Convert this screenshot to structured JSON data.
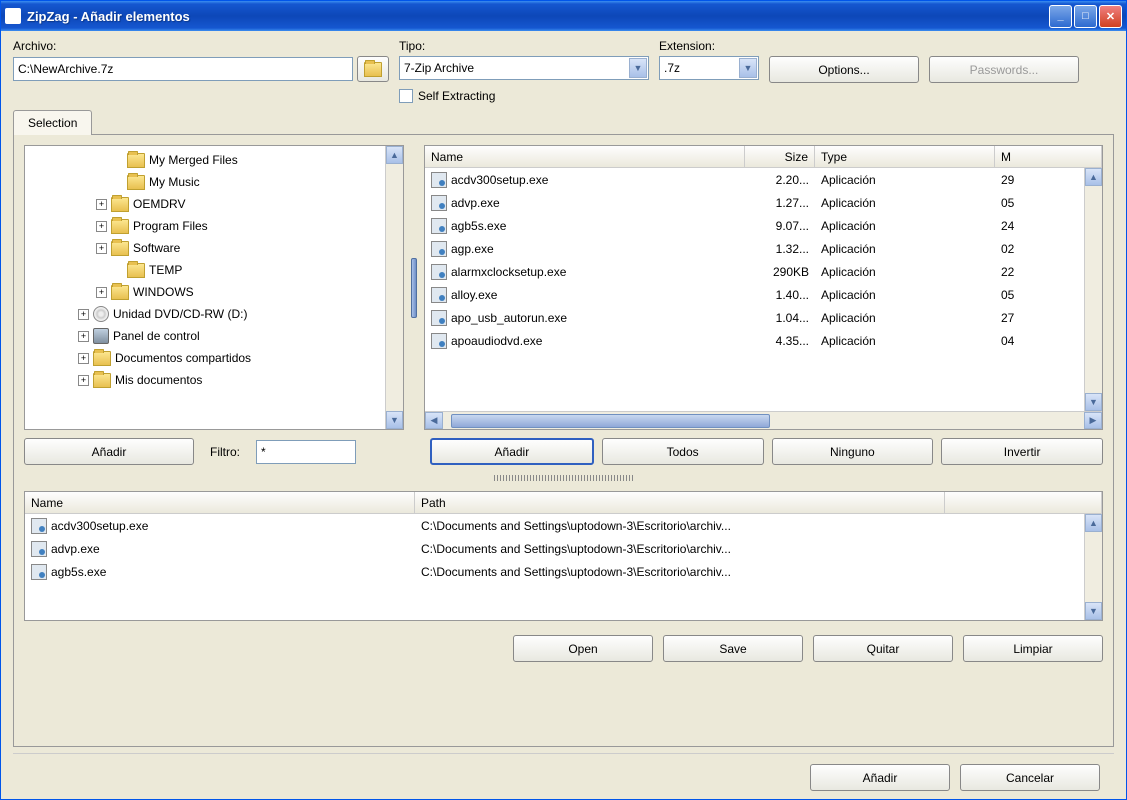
{
  "window": {
    "title": "ZipZag - Añadir elementos"
  },
  "fields": {
    "archivo_label": "Archivo:",
    "archivo_value": "C:\\NewArchive.7z",
    "tipo_label": "Tipo:",
    "tipo_value": "7-Zip Archive",
    "extension_label": "Extension:",
    "extension_value": ".7z",
    "options_btn": "Options...",
    "passwords_btn": "Passwords...",
    "self_extracting": "Self Extracting"
  },
  "tab": {
    "selection": "Selection"
  },
  "tree": {
    "items": [
      {
        "indent": 80,
        "expand": "",
        "icon": "folder",
        "label": "My Merged Files"
      },
      {
        "indent": 80,
        "expand": "",
        "icon": "folder",
        "label": "My Music"
      },
      {
        "indent": 64,
        "expand": "+",
        "icon": "folder",
        "label": "OEMDRV"
      },
      {
        "indent": 64,
        "expand": "+",
        "icon": "folder",
        "label": "Program Files"
      },
      {
        "indent": 64,
        "expand": "+",
        "icon": "folder",
        "label": "Software"
      },
      {
        "indent": 80,
        "expand": "",
        "icon": "folder",
        "label": "TEMP"
      },
      {
        "indent": 64,
        "expand": "+",
        "icon": "folder",
        "label": "WINDOWS"
      },
      {
        "indent": 46,
        "expand": "+",
        "icon": "cd",
        "label": "Unidad DVD/CD-RW (D:)"
      },
      {
        "indent": 46,
        "expand": "+",
        "icon": "panel",
        "label": "Panel de control"
      },
      {
        "indent": 46,
        "expand": "+",
        "icon": "folder",
        "label": "Documentos compartidos"
      },
      {
        "indent": 46,
        "expand": "+",
        "icon": "folder",
        "label": "Mis documentos"
      }
    ]
  },
  "filelist": {
    "cols": {
      "name": "Name",
      "size": "Size",
      "type": "Type",
      "m": "M"
    },
    "rows": [
      {
        "name": "acdv300setup.exe",
        "size": "2.20...",
        "type": "Aplicación",
        "m": "29"
      },
      {
        "name": "advp.exe",
        "size": "1.27...",
        "type": "Aplicación",
        "m": "05"
      },
      {
        "name": "agb5s.exe",
        "size": "9.07...",
        "type": "Aplicación",
        "m": "24"
      },
      {
        "name": "agp.exe",
        "size": "1.32...",
        "type": "Aplicación",
        "m": "02"
      },
      {
        "name": "alarmxclocksetup.exe",
        "size": "290KB",
        "type": "Aplicación",
        "m": "22"
      },
      {
        "name": "alloy.exe",
        "size": "1.40...",
        "type": "Aplicación",
        "m": "05"
      },
      {
        "name": "apo_usb_autorun.exe",
        "size": "1.04...",
        "type": "Aplicación",
        "m": "27"
      },
      {
        "name": "apoaudiodvd.exe",
        "size": "4.35...",
        "type": "Aplicación",
        "m": "04"
      }
    ]
  },
  "buttons": {
    "anadir_tree": "Añadir",
    "filtro_label": "Filtro:",
    "filtro_value": "*",
    "anadir_list": "Añadir",
    "todos": "Todos",
    "ninguno": "Ninguno",
    "invertir": "Invertir",
    "open": "Open",
    "save": "Save",
    "quitar": "Quitar",
    "limpiar": "Limpiar",
    "anadir_dialog": "Añadir",
    "cancelar": "Cancelar"
  },
  "selected": {
    "cols": {
      "name": "Name",
      "path": "Path"
    },
    "rows": [
      {
        "name": "acdv300setup.exe",
        "path": "C:\\Documents and Settings\\uptodown-3\\Escritorio\\archiv..."
      },
      {
        "name": "advp.exe",
        "path": "C:\\Documents and Settings\\uptodown-3\\Escritorio\\archiv..."
      },
      {
        "name": "agb5s.exe",
        "path": "C:\\Documents and Settings\\uptodown-3\\Escritorio\\archiv..."
      }
    ]
  }
}
